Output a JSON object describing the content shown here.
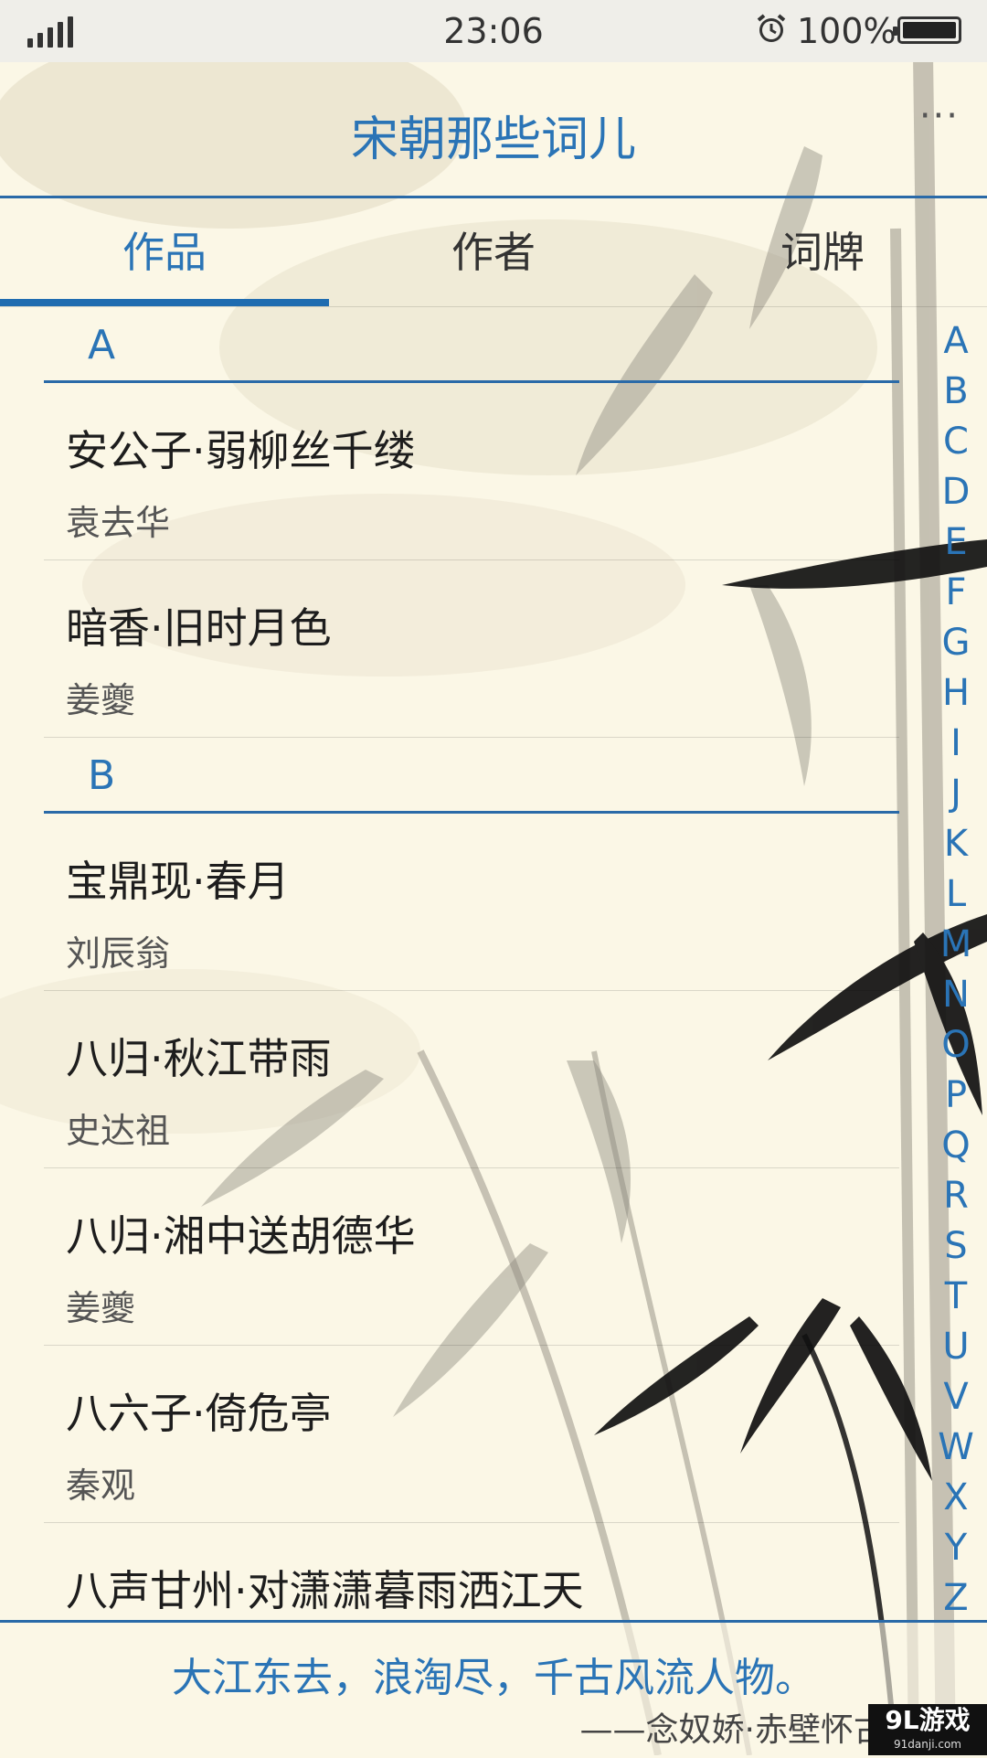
{
  "status_bar": {
    "time": "23:06",
    "battery": "100%"
  },
  "header": {
    "title": "宋朝那些词儿",
    "more": "···"
  },
  "tabs": [
    {
      "label": "作品",
      "active": true
    },
    {
      "label": "作者",
      "active": false
    },
    {
      "label": "词牌",
      "active": false
    }
  ],
  "list": {
    "sections": [
      {
        "letter": "A",
        "items": [
          {
            "title": "安公子·弱柳丝千缕",
            "author": "袁去华"
          },
          {
            "title": "暗香·旧时月色",
            "author": "姜夔"
          }
        ]
      },
      {
        "letter": "B",
        "items": [
          {
            "title": "宝鼎现·春月",
            "author": "刘辰翁"
          },
          {
            "title": "八归·秋江带雨",
            "author": "史达祖"
          },
          {
            "title": "八归·湘中送胡德华",
            "author": "姜夔"
          },
          {
            "title": "八六子·倚危亭",
            "author": "秦观"
          },
          {
            "title": "八声甘州·对潇潇暮雨洒江天",
            "author": ""
          }
        ]
      }
    ]
  },
  "alphabet_index": [
    "A",
    "B",
    "C",
    "D",
    "E",
    "F",
    "G",
    "H",
    "I",
    "J",
    "K",
    "L",
    "M",
    "N",
    "O",
    "P",
    "Q",
    "R",
    "S",
    "T",
    "U",
    "V",
    "W",
    "X",
    "Y",
    "Z"
  ],
  "footer": {
    "quote": "大江东去，浪淘尽，千古风流人物。",
    "source": "——念奴娇·赤壁怀古"
  },
  "watermark": {
    "main": "9L游戏",
    "sub": "91danji.com"
  },
  "colors": {
    "accent": "#2a74b6",
    "background": "#fbf7e6",
    "status_bar": "#efeee9"
  }
}
